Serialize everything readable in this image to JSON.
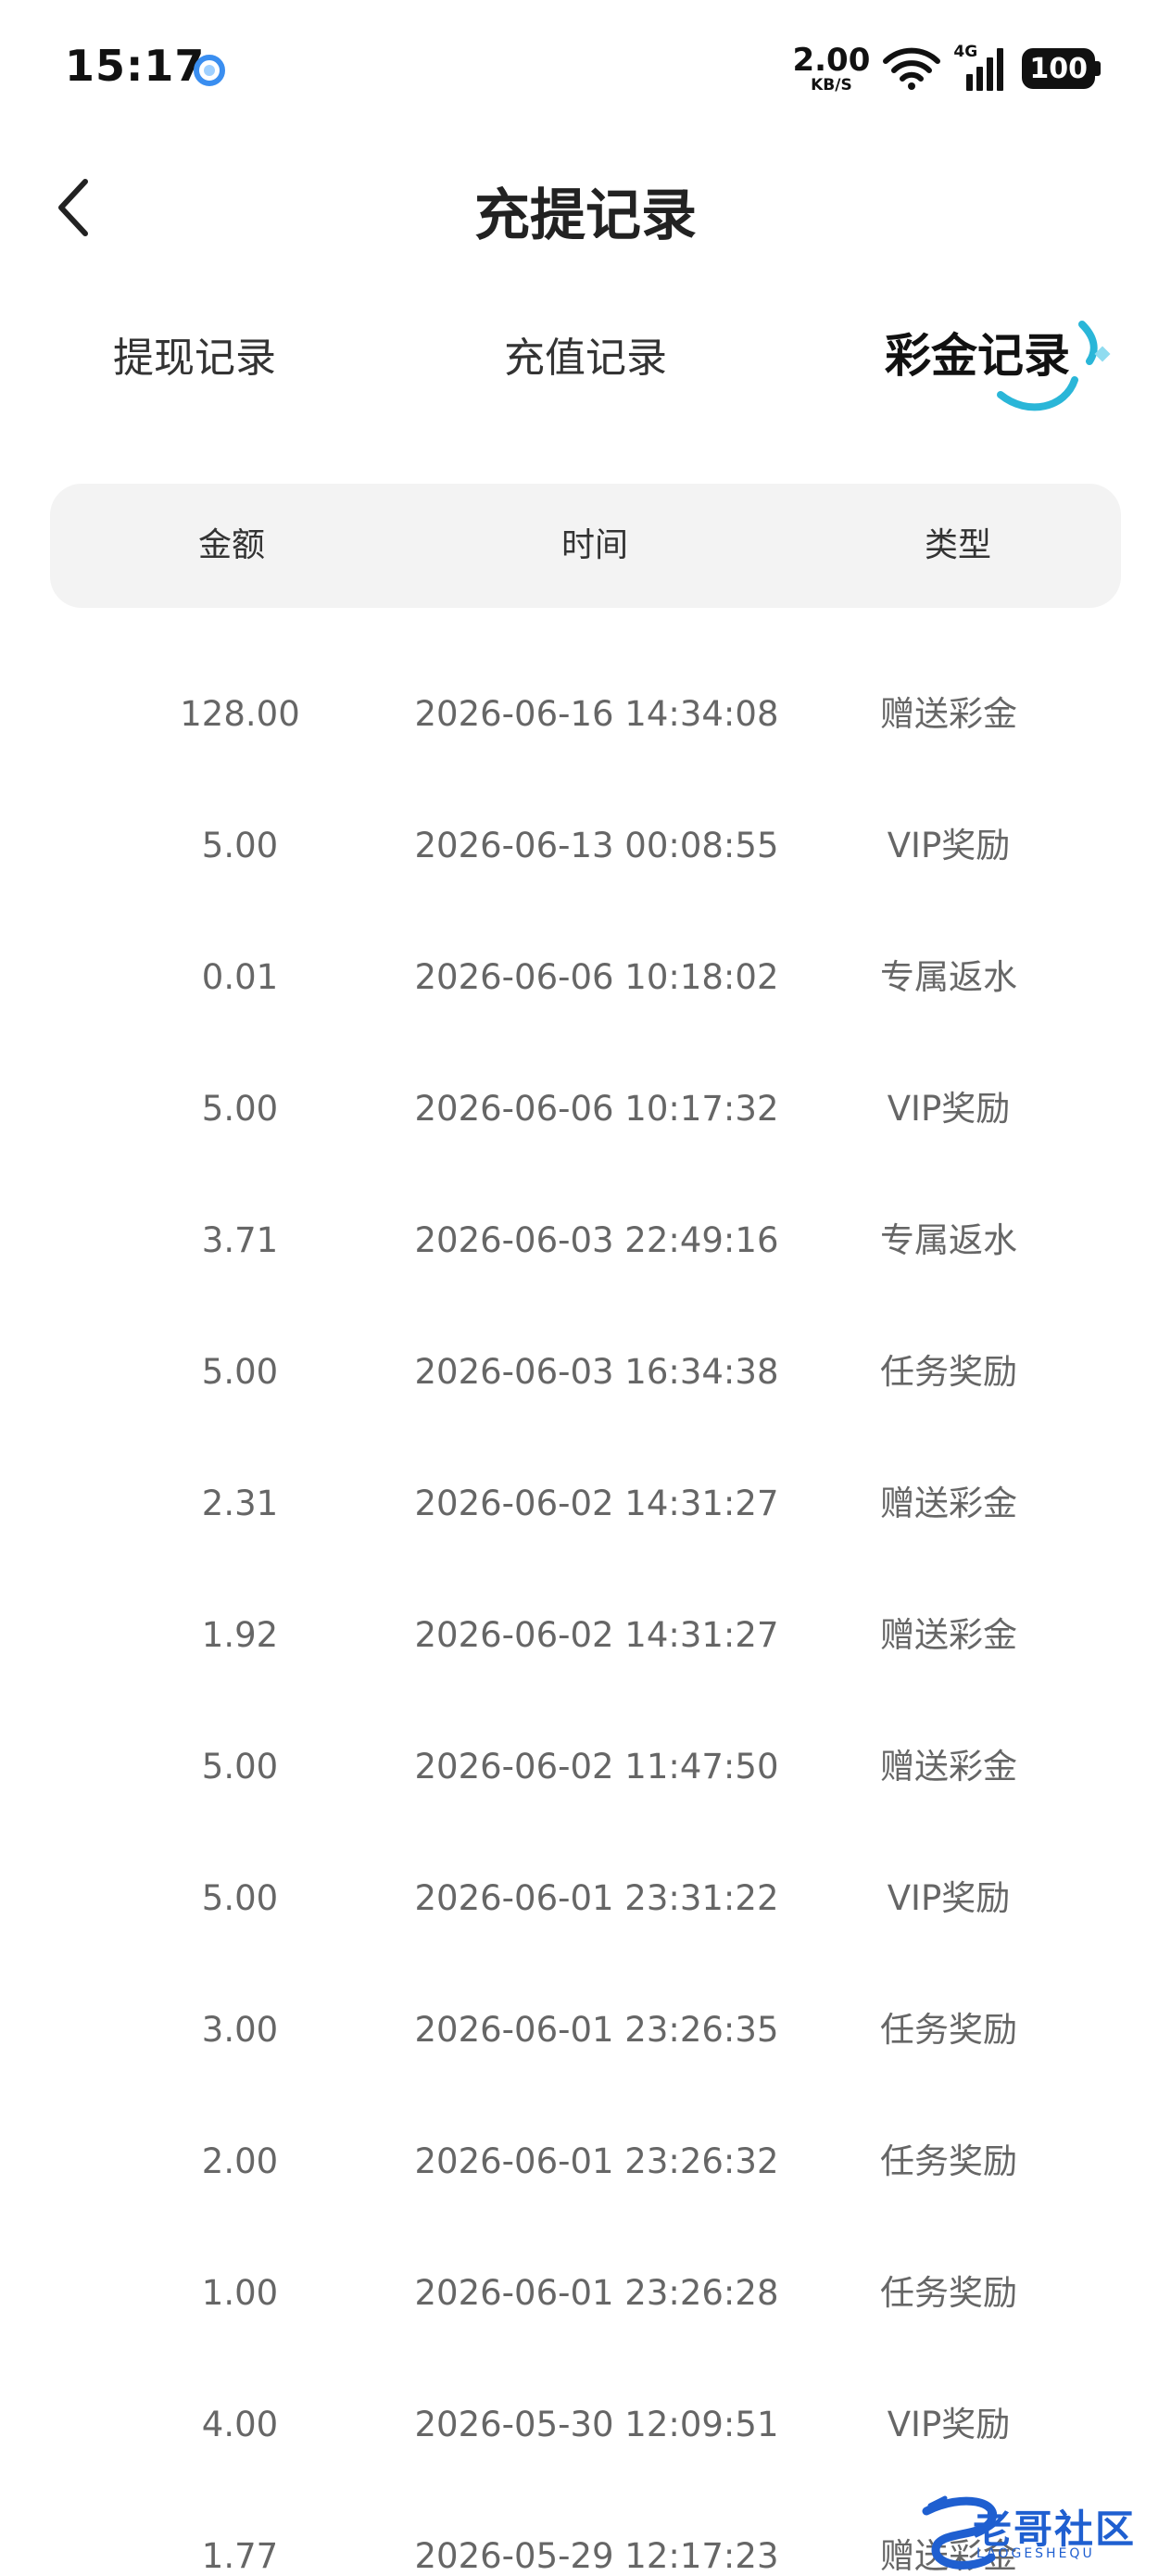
{
  "status_bar": {
    "time": "15:17",
    "net_speed_value": "2.00",
    "net_speed_unit": "KB/S",
    "network_type": "4G",
    "battery": "100"
  },
  "header": {
    "title": "充提记录"
  },
  "tabs": [
    {
      "label": "提现记录",
      "active": false
    },
    {
      "label": "充值记录",
      "active": false
    },
    {
      "label": "彩金记录",
      "active": true
    }
  ],
  "table": {
    "columns": [
      "金额",
      "时间",
      "类型"
    ],
    "rows": [
      {
        "amount": "128.00",
        "time": "2026-06-16 14:34:08",
        "type": "赠送彩金"
      },
      {
        "amount": "5.00",
        "time": "2026-06-13 00:08:55",
        "type": "VIP奖励"
      },
      {
        "amount": "0.01",
        "time": "2026-06-06 10:18:02",
        "type": "专属返水"
      },
      {
        "amount": "5.00",
        "time": "2026-06-06 10:17:32",
        "type": "VIP奖励"
      },
      {
        "amount": "3.71",
        "time": "2026-06-03 22:49:16",
        "type": "专属返水"
      },
      {
        "amount": "5.00",
        "time": "2026-06-03 16:34:38",
        "type": "任务奖励"
      },
      {
        "amount": "2.31",
        "time": "2026-06-02 14:31:27",
        "type": "赠送彩金"
      },
      {
        "amount": "1.92",
        "time": "2026-06-02 14:31:27",
        "type": "赠送彩金"
      },
      {
        "amount": "5.00",
        "time": "2026-06-02 11:47:50",
        "type": "赠送彩金"
      },
      {
        "amount": "5.00",
        "time": "2026-06-01 23:31:22",
        "type": "VIP奖励"
      },
      {
        "amount": "3.00",
        "time": "2026-06-01 23:26:35",
        "type": "任务奖励"
      },
      {
        "amount": "2.00",
        "time": "2026-06-01 23:26:32",
        "type": "任务奖励"
      },
      {
        "amount": "1.00",
        "time": "2026-06-01 23:26:28",
        "type": "任务奖励"
      },
      {
        "amount": "4.00",
        "time": "2026-05-30 12:09:51",
        "type": "VIP奖励"
      },
      {
        "amount": "1.77",
        "time": "2026-05-29 12:17:23",
        "type": "赠送彩金"
      }
    ]
  },
  "watermark": {
    "text": "老哥社区",
    "sub": "LAOGESHEQU"
  },
  "colors": {
    "accent": "#2ab6d8",
    "header_bg": "#f3f3f3",
    "row_text": "#666666"
  },
  "icons": {
    "back": "chevron-left-icon",
    "wifi": "wifi-icon",
    "signal": "signal-icon",
    "battery": "battery-icon",
    "app": "app-notification-icon"
  }
}
